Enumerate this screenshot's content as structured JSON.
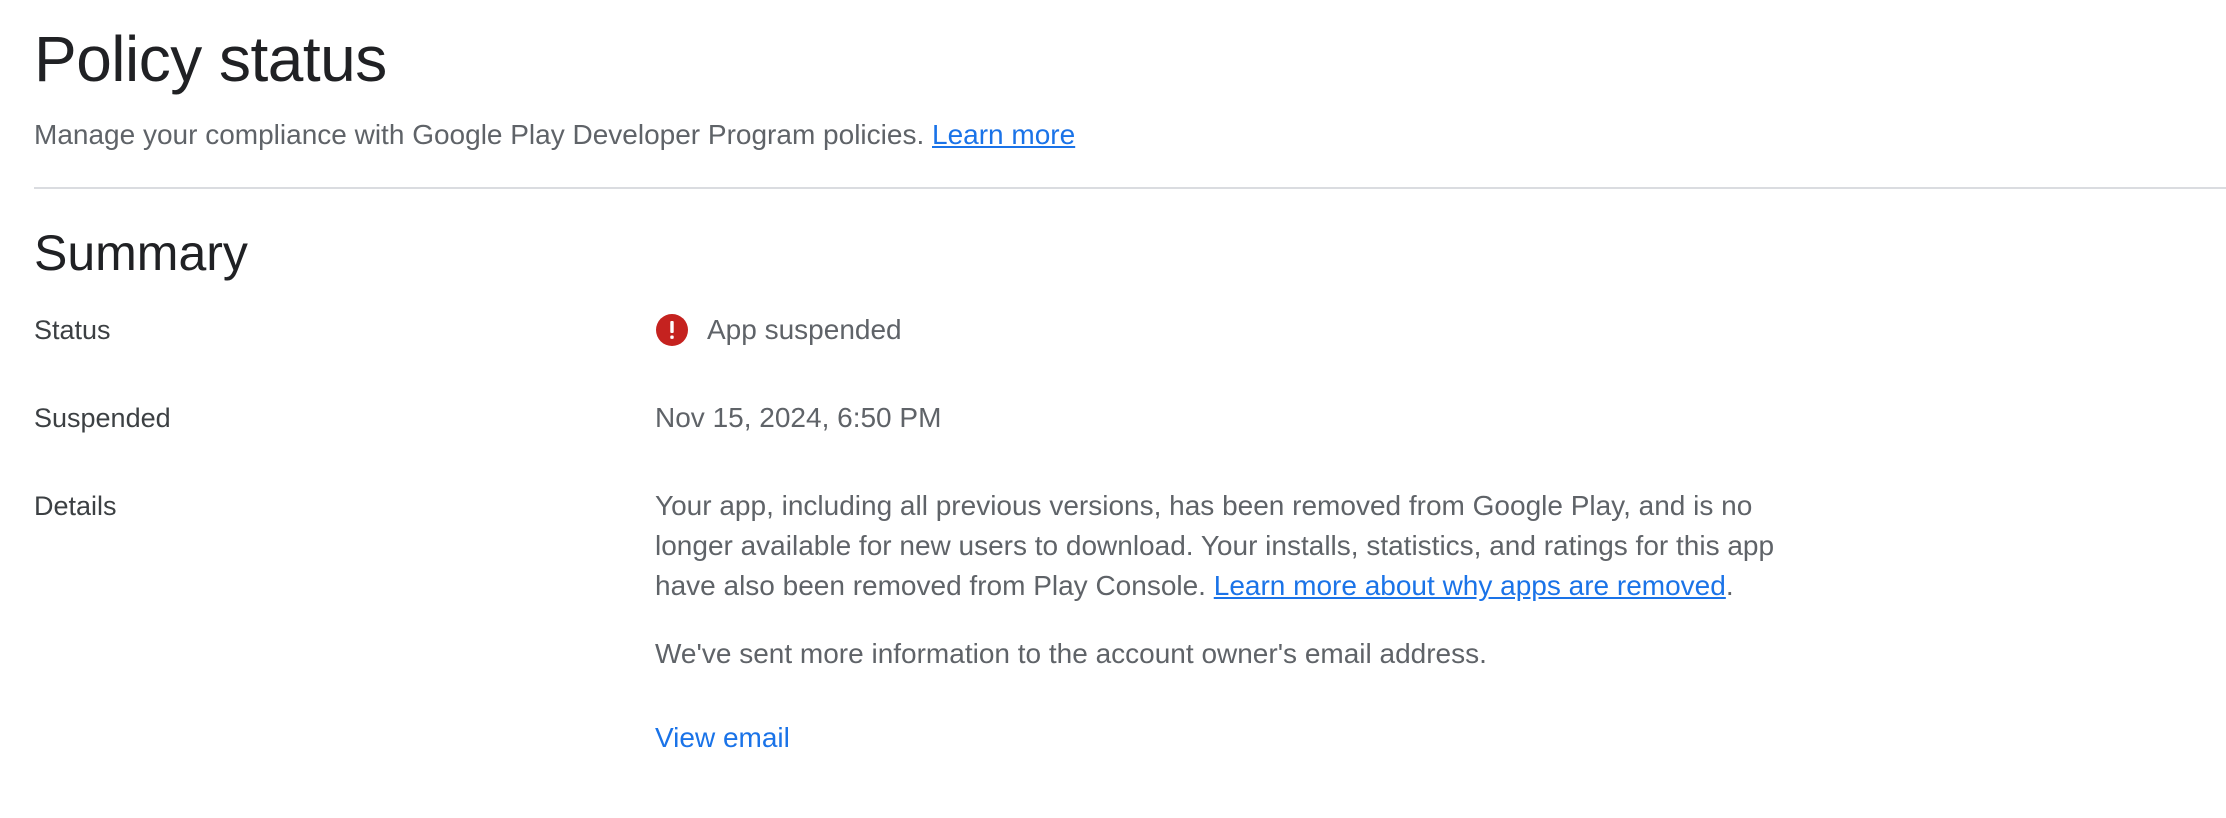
{
  "header": {
    "title": "Policy status",
    "subtitle": "Manage your compliance with Google Play Developer Program policies.",
    "learn_more": "Learn more"
  },
  "summary": {
    "title": "Summary",
    "status": {
      "label": "Status",
      "value": "App suspended",
      "icon": "error-icon",
      "icon_color": "#c5221f"
    },
    "suspended": {
      "label": "Suspended",
      "value": "Nov 15, 2024, 6:50 PM"
    },
    "details": {
      "label": "Details",
      "text": "Your app, including all previous versions, has been removed from Google Play, and is no longer available for new users to download. Your installs, statistics, and ratings for this app have also been removed from Play Console.",
      "link": "Learn more about why apps are removed",
      "link_suffix": ".",
      "email_note": "We've sent more information to the account owner's email address.",
      "view_email": "View email"
    }
  },
  "colors": {
    "link": "#1a73e8",
    "error": "#c5221f",
    "divider": "#dadce0"
  }
}
